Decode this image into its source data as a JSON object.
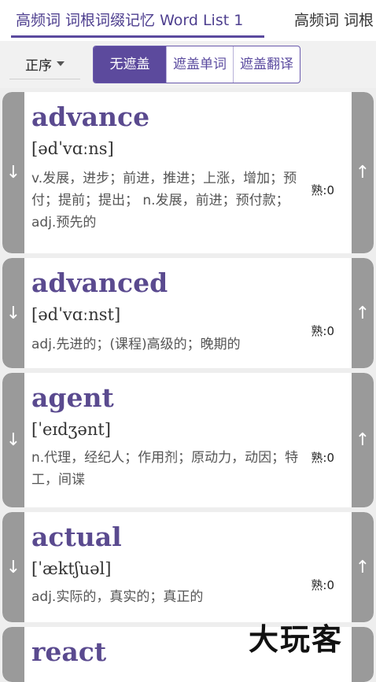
{
  "tabs": [
    {
      "label": "高频词 词根词缀记忆 Word List 1",
      "active": true
    },
    {
      "label": "高频词 词根",
      "active": false
    }
  ],
  "toolbar": {
    "sort_label": "正序",
    "segments": [
      "无遮盖",
      "遮盖单词",
      "遮盖翻译"
    ],
    "selected_segment": "无遮盖"
  },
  "cards": [
    {
      "word": "advance",
      "phonetic": "[ədˈvɑːns]",
      "definition": "v.发展，进步；前进，推进；上涨，增加；预付；提前；提出；  n.发展，前进；预付款；  adj.预先的",
      "familiarity": "熟:0"
    },
    {
      "word": "advanced",
      "phonetic": "[ədˈvɑːnst]",
      "definition": "adj.先进的；(课程)高级的；晚期的",
      "familiarity": "熟:0"
    },
    {
      "word": "agent",
      "phonetic": "[ˈeɪdʒənt]",
      "definition": "n.代理，经纪人；作用剂；原动力，动因；特工，间谍",
      "familiarity": "熟:0"
    },
    {
      "word": "actual",
      "phonetic": "[ˈæktʃuəl]",
      "definition": "adj.实际的，真实的；真正的",
      "familiarity": "熟:0"
    },
    {
      "word": "react",
      "phonetic": "",
      "definition": "",
      "familiarity": ""
    }
  ],
  "watermark": "大玩客",
  "icons": {
    "down": "arrow-down-icon",
    "up": "arrow-up-icon"
  },
  "colors": {
    "accent": "#5c4a9d",
    "word": "#5a4a8f",
    "side": "#9a9a9a"
  }
}
